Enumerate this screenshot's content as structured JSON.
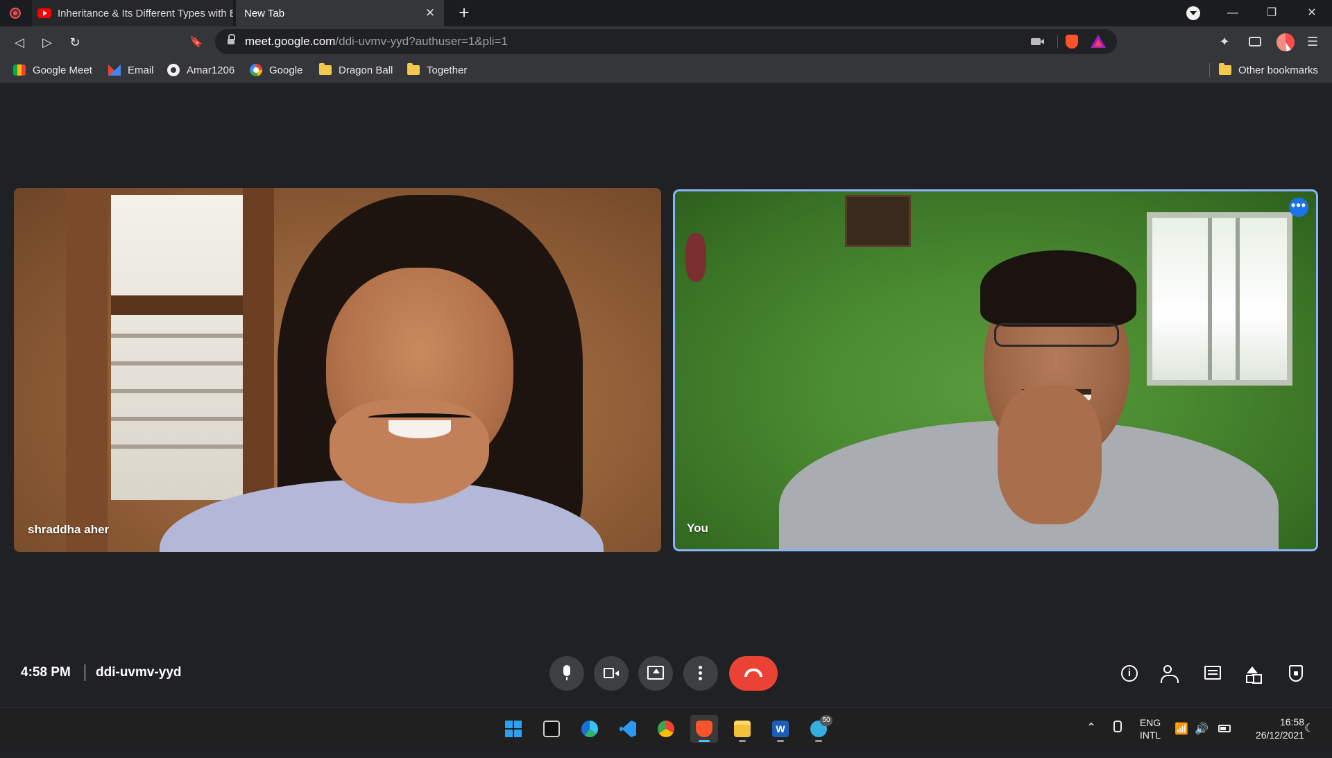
{
  "browser": {
    "tabs": [
      {
        "title": "Inheritance & Its Different Types with Example",
        "icon": "youtube-icon"
      },
      {
        "title": "New Tab",
        "close": "✕"
      }
    ],
    "new_tab_label": "+",
    "window_controls": {
      "minimize": "—",
      "restore": "❐",
      "close": "✕"
    }
  },
  "toolbar": {
    "back": "◁",
    "forward": "▷",
    "reload": "↻",
    "bookmark": "🔖",
    "url_host": "meet.google.com",
    "url_path": "/ddi-uvmv-yyd?authuser=1&pli=1",
    "extensions": "✦",
    "menu": "☰"
  },
  "bookmarks": [
    {
      "label": "Google Meet",
      "icon": "google-meet-icon"
    },
    {
      "label": "Email",
      "icon": "gmail-icon"
    },
    {
      "label": "Amar1206",
      "icon": "github-icon"
    },
    {
      "label": "Google",
      "icon": "google-icon"
    },
    {
      "label": "Dragon Ball",
      "icon": "folder-icon"
    },
    {
      "label": "Together",
      "icon": "folder-icon"
    }
  ],
  "other_bookmarks": "Other bookmarks",
  "meet": {
    "participants": [
      {
        "name": "shraddha aher"
      },
      {
        "name": "You"
      }
    ],
    "more_options": "•••",
    "time": "4:58 PM",
    "meeting_code": "ddi-uvmv-yyd",
    "people_count": "2",
    "info_glyph": "i",
    "accent_color": "#8ab4f8",
    "end_call_color": "#ea4335"
  },
  "taskbar": {
    "apps": [
      "start",
      "terminal",
      "edge",
      "vscode",
      "chrome",
      "brave",
      "file-explorer",
      "word",
      "telegram"
    ],
    "telegram_badge": "50",
    "word_glyph": "W",
    "chevron": "⌃",
    "lang_primary": "ENG",
    "lang_secondary": "INTL",
    "wifi": "📶",
    "volume": "🔊",
    "notif": "☾",
    "time": "16:58",
    "date": "26/12/2021"
  }
}
